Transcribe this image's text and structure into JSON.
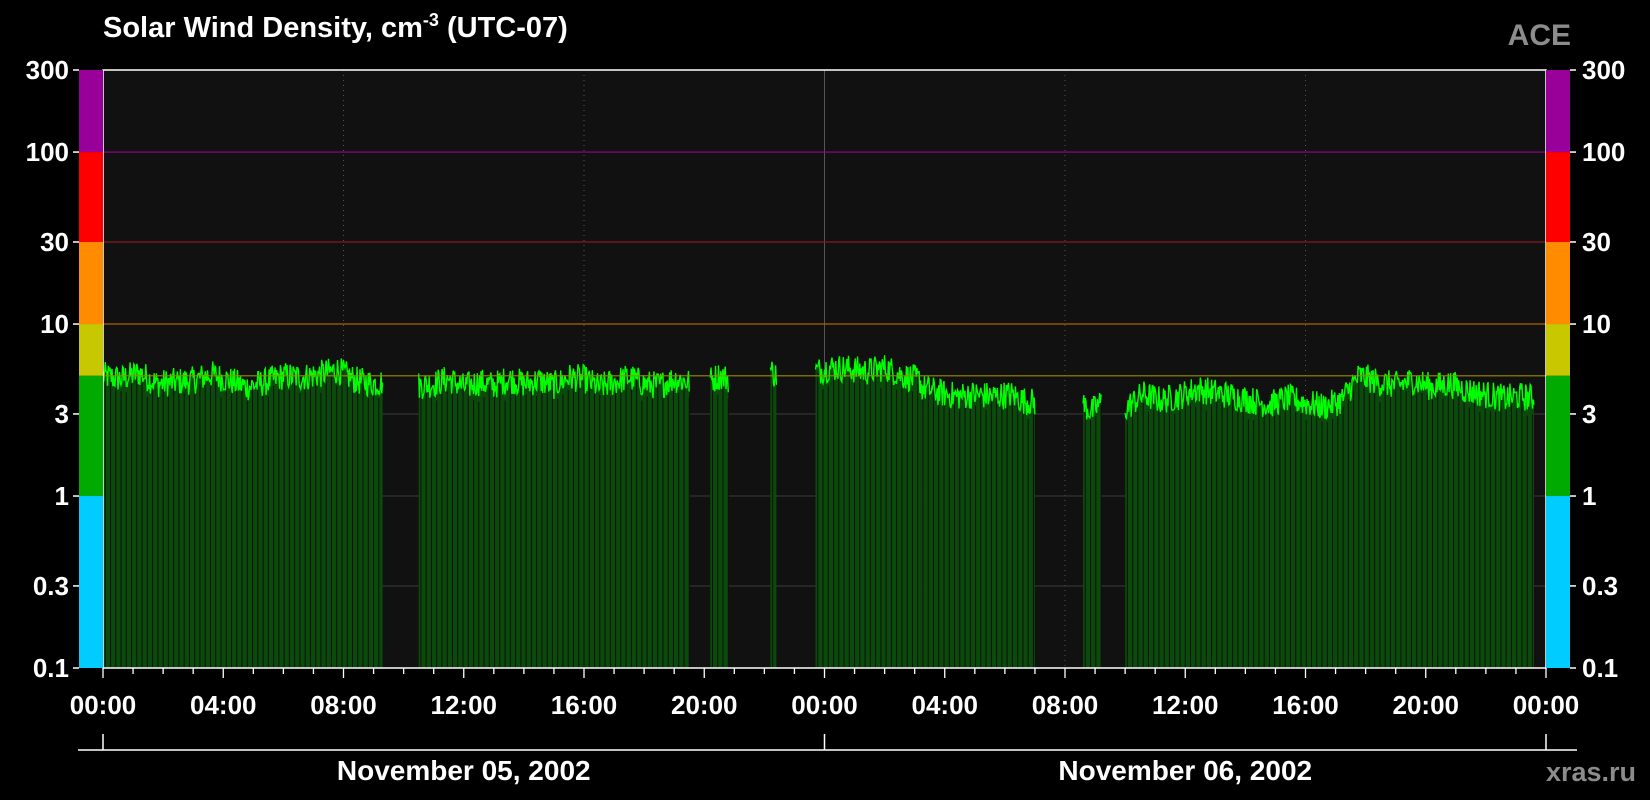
{
  "title": {
    "main": "Solar Wind Density, cm",
    "superscript": "-3",
    "suffix": " (UTC-07)"
  },
  "watermark_top": "ACE",
  "watermark_bottom": "xras.ru",
  "colors": {
    "background": "#000000",
    "plot_background": "#111111",
    "data_line": "#00ff00",
    "data_fill": "#0a4a0a",
    "band_purple": "#990099",
    "band_red": "#ff0000",
    "band_orange": "#ff8c00",
    "band_yellow": "#c8c800",
    "band_green": "#00aa00",
    "band_cyan": "#00ccff"
  },
  "chart_data": {
    "type": "area",
    "title": "Solar Wind Density, cm-3 (UTC-07)",
    "y_scale": "log",
    "ylim": [
      0.1,
      300
    ],
    "y_ticks": [
      "0.1",
      "0.3",
      "1",
      "3",
      "10",
      "30",
      "100",
      "300"
    ],
    "y_tick_values": [
      0.1,
      0.3,
      1,
      3,
      10,
      30,
      100,
      300
    ],
    "xlim_hours": [
      0,
      48
    ],
    "x_ticks": [
      "00:00",
      "04:00",
      "08:00",
      "12:00",
      "16:00",
      "20:00",
      "00:00",
      "04:00",
      "08:00",
      "12:00",
      "16:00",
      "20:00",
      "00:00"
    ],
    "dates": [
      {
        "label": "November 05, 2002",
        "start_hour": 0
      },
      {
        "label": "November 06, 2002",
        "start_hour": 24
      }
    ],
    "threshold_lines": [
      {
        "value": 100,
        "color": "#990099"
      },
      {
        "value": 30,
        "color": "#8b1a1a"
      },
      {
        "value": 10,
        "color": "#b36200"
      },
      {
        "value": 5,
        "color": "#9a8a00"
      }
    ],
    "color_bands": [
      {
        "from": 100,
        "to": 300,
        "color": "#990099"
      },
      {
        "from": 30,
        "to": 100,
        "color": "#ff0000"
      },
      {
        "from": 10,
        "to": 30,
        "color": "#ff8c00"
      },
      {
        "from": 5,
        "to": 10,
        "color": "#c8c800"
      },
      {
        "from": 1,
        "to": 5,
        "color": "#00aa00"
      },
      {
        "from": 0.1,
        "to": 1,
        "color": "#00ccff"
      }
    ],
    "series": [
      {
        "segments": [
          {
            "start_hour": 0.0,
            "end_hour": 9.3,
            "points": [
              [
                0.0,
                5.0
              ],
              [
                0.6,
                4.8
              ],
              [
                1.2,
                5.2
              ],
              [
                1.8,
                4.5
              ],
              [
                2.4,
                4.6
              ],
              [
                3.0,
                4.7
              ],
              [
                3.6,
                5.1
              ],
              [
                4.2,
                4.7
              ],
              [
                4.8,
                4.3
              ],
              [
                5.4,
                4.6
              ],
              [
                6.0,
                5.0
              ],
              [
                6.6,
                4.9
              ],
              [
                7.2,
                5.1
              ],
              [
                7.8,
                5.4
              ],
              [
                8.4,
                4.7
              ],
              [
                9.0,
                4.5
              ],
              [
                9.3,
                4.6
              ]
            ]
          },
          {
            "start_hour": 10.5,
            "end_hour": 19.5,
            "points": [
              [
                10.5,
                4.4
              ],
              [
                11.0,
                4.5
              ],
              [
                11.5,
                4.8
              ],
              [
                12.0,
                4.3
              ],
              [
                12.5,
                4.6
              ],
              [
                13.0,
                4.4
              ],
              [
                13.5,
                4.8
              ],
              [
                14.0,
                4.5
              ],
              [
                14.5,
                4.7
              ],
              [
                15.0,
                4.4
              ],
              [
                15.5,
                4.9
              ],
              [
                16.0,
                4.8
              ],
              [
                16.5,
                4.3
              ],
              [
                17.0,
                4.6
              ],
              [
                17.5,
                4.9
              ],
              [
                18.0,
                4.5
              ],
              [
                18.5,
                4.4
              ],
              [
                19.0,
                4.8
              ],
              [
                19.5,
                4.6
              ]
            ]
          },
          {
            "start_hour": 20.2,
            "end_hour": 20.8,
            "points": [
              [
                20.2,
                4.7
              ],
              [
                20.5,
                5.0
              ],
              [
                20.8,
                4.8
              ]
            ]
          },
          {
            "start_hour": 22.2,
            "end_hour": 22.4,
            "points": [
              [
                22.2,
                5.4
              ],
              [
                22.4,
                5.0
              ]
            ]
          },
          {
            "start_hour": 23.7,
            "end_hour": 27.2,
            "points": [
              [
                23.7,
                5.3
              ],
              [
                24.2,
                5.6
              ],
              [
                24.8,
                5.5
              ],
              [
                25.4,
                5.3
              ],
              [
                26.0,
                5.6
              ],
              [
                26.6,
                5.0
              ],
              [
                27.2,
                4.7
              ]
            ]
          },
          {
            "start_hour": 27.2,
            "end_hour": 31.0,
            "points": [
              [
                27.2,
                4.3
              ],
              [
                27.8,
                4.0
              ],
              [
                28.4,
                3.8
              ],
              [
                29.0,
                3.9
              ],
              [
                29.6,
                3.8
              ],
              [
                30.2,
                3.9
              ],
              [
                30.6,
                3.6
              ],
              [
                31.0,
                3.5
              ]
            ]
          },
          {
            "start_hour": 32.6,
            "end_hour": 33.2,
            "points": [
              [
                32.6,
                3.4
              ],
              [
                32.9,
                3.1
              ],
              [
                33.2,
                3.5
              ]
            ]
          },
          {
            "start_hour": 34.0,
            "end_hour": 47.6,
            "points": [
              [
                34.0,
                3.2
              ],
              [
                34.6,
                3.9
              ],
              [
                35.2,
                3.6
              ],
              [
                35.8,
                3.8
              ],
              [
                36.4,
                4.2
              ],
              [
                37.0,
                4.0
              ],
              [
                37.6,
                3.8
              ],
              [
                38.2,
                3.6
              ],
              [
                38.8,
                3.4
              ],
              [
                39.4,
                3.7
              ],
              [
                40.0,
                3.5
              ],
              [
                40.6,
                3.3
              ],
              [
                41.2,
                3.6
              ],
              [
                41.8,
                5.0
              ],
              [
                42.4,
                4.6
              ],
              [
                43.0,
                4.4
              ],
              [
                43.6,
                4.7
              ],
              [
                44.2,
                4.3
              ],
              [
                44.8,
                4.5
              ],
              [
                45.4,
                4.1
              ],
              [
                46.0,
                3.9
              ],
              [
                46.6,
                3.7
              ],
              [
                47.2,
                3.8
              ],
              [
                47.6,
                3.7
              ]
            ]
          }
        ]
      }
    ]
  }
}
